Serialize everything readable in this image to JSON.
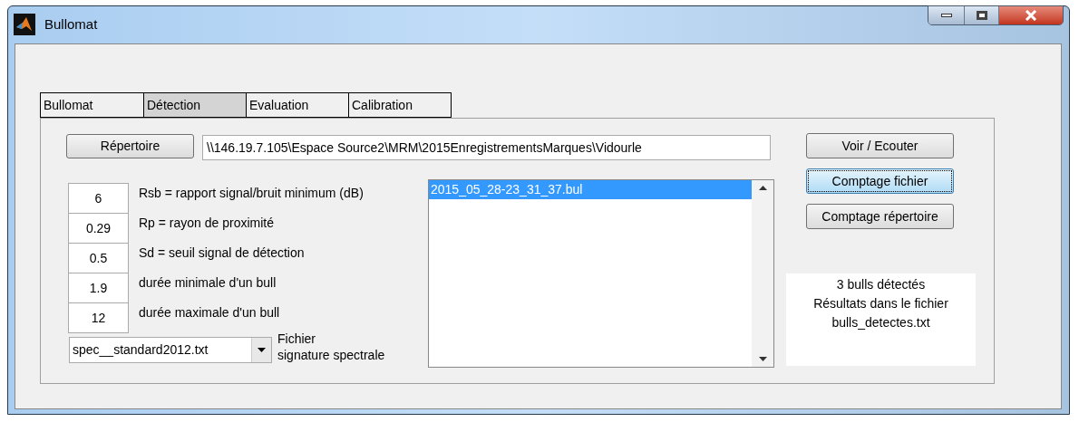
{
  "window": {
    "title": "Bullomat"
  },
  "tabs": [
    {
      "label": "Bullomat",
      "selected": false
    },
    {
      "label": "Détection",
      "selected": true
    },
    {
      "label": "Evaluation",
      "selected": false
    },
    {
      "label": "Calibration",
      "selected": false
    }
  ],
  "directory_button": "Répertoire",
  "path_field": {
    "value": "\\\\146.19.7.105\\Espace Source2\\MRM\\2015EnregistrementsMarques\\Vidourle"
  },
  "parameters": [
    {
      "value": "6",
      "label": "Rsb = rapport signal/bruit minimum (dB)"
    },
    {
      "value": "0.29",
      "label": "Rp = rayon de proximité"
    },
    {
      "value": "0.5",
      "label": "Sd = seuil signal de détection"
    },
    {
      "value": "1.9",
      "label": "durée minimale d'un bull"
    },
    {
      "value": "12",
      "label": "durée maximale d'un bull"
    }
  ],
  "spectral_file": {
    "value": "spec__standard2012.txt",
    "label_lines": [
      "Fichier",
      "signature spectrale"
    ]
  },
  "file_list": [
    {
      "name": "2015_05_28-23_31_37.bul",
      "selected": true
    }
  ],
  "buttons": [
    {
      "label": "Voir / Ecouter",
      "focused": false
    },
    {
      "label": "Comptage fichier",
      "focused": true
    },
    {
      "label": "Comptage répertoire",
      "focused": false
    }
  ],
  "result_lines": [
    "3 bulls détectés",
    "Résultats dans le fichier",
    "bulls_detectes.txt"
  ]
}
